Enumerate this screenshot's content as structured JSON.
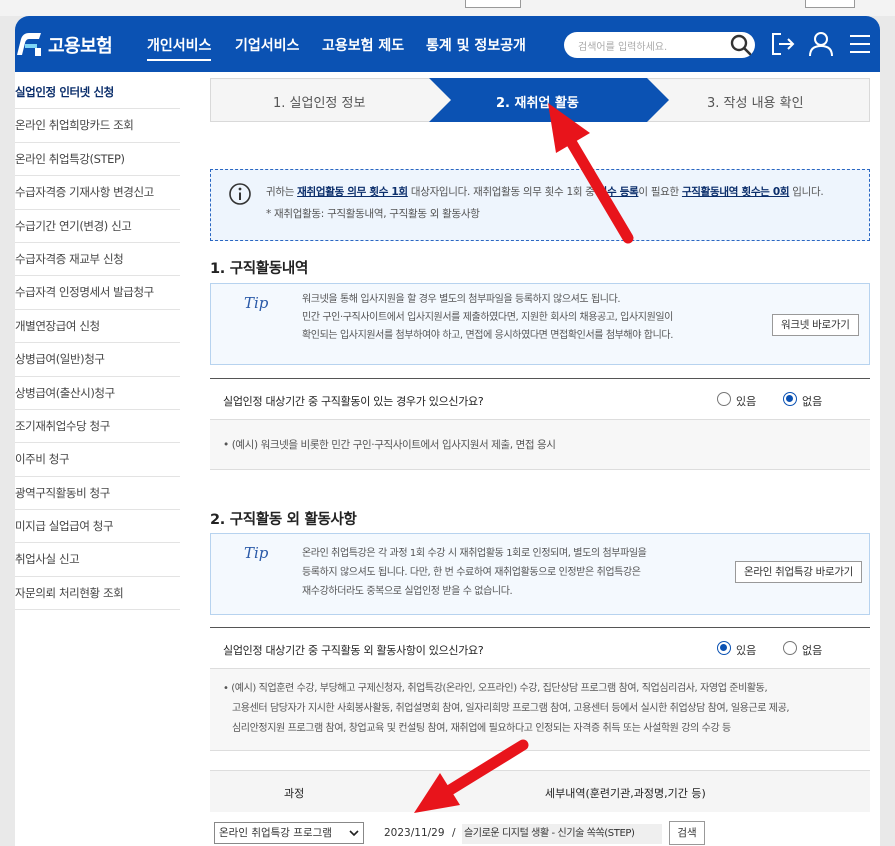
{
  "header": {
    "logo_text": "고용보험",
    "nav": [
      "개인서비스",
      "기업서비스",
      "고용보험 제도",
      "통계 및 정보공개"
    ],
    "search_placeholder": "검색어를 입력하세요."
  },
  "sidebar": {
    "items": [
      "실업인정 인터넷 신청",
      "온라인 취업희망카드 조회",
      "온라인 취업특강(STEP)",
      "수급자격증 기재사항 변경신고",
      "수급기간 연기(변경) 신고",
      "수급자격증 재교부 신청",
      "수급자격 인정명세서 발급청구",
      "개별연장급여 신청",
      "상병급여(일반)청구",
      "상병급여(출산시)청구",
      "조기재취업수당 청구",
      "이주비 청구",
      "광역구직활동비 청구",
      "미지급 실업급여 청구",
      "취업사실 신고",
      "자문의뢰 처리현황 조회"
    ]
  },
  "steps": [
    "1. 실업인정 정보",
    "2. 재취업 활동",
    "3. 작성 내용 확인"
  ],
  "notice": {
    "p1": "귀하는 ",
    "b1": "재취업활동 의무 횟수 1회",
    "p2": " 대상자입니다. 재취업활동 의무 횟수 1회 중 ",
    "b2": "필수 등록",
    "p3": "이 필요한 ",
    "b3": "구직활동내역 횟수는 0회",
    "p4": " 입니다.",
    "line2": "* 재취업활동: 구직활동내역, 구직활동 외 활동사항"
  },
  "section1": {
    "title": "1. 구직활동내역",
    "tip_logo": "Tip",
    "tip_lines": [
      "워크넷을 통해 입사지원을 할 경우 별도의 첨부파일을 등록하지 않으셔도 됩니다.",
      "민간 구인·구직사이트에서 입사지원서를 제출하였다면, 지원한 회사의 채용공고, 입사지원일이",
      "확인되는 입사지원서를 첨부하여야 하고, 면접에 응시하였다면 면접확인서를 첨부해야 합니다."
    ],
    "tip_button": "워크넷 바로가기",
    "question": "실업인정 대상기간 중 구직활동이 있는 경우가 있으신가요?",
    "yes": "있음",
    "no": "없음",
    "selected": "없음",
    "example": "• (예시) 워크넷을 비롯한 민간 구인·구직사이트에서 입사지원서 제출, 면접 응시"
  },
  "section2": {
    "title": "2. 구직활동 외 활동사항",
    "tip_logo": "Tip",
    "tip_lines": [
      "온라인 취업특강은 각 과정 1회 수강 시 재취업활동 1회로 인정되며, 별도의 첨부파일을",
      "등록하지 않으셔도 됩니다. 다만, 한 번 수료하여 재취업활동으로 인정받은 취업특강은",
      "재수강하더라도 중복으로 실업인정 받을 수 없습니다."
    ],
    "tip_button": "온라인 취업특강 바로가기",
    "question": "실업인정 대상기간 중 구직활동 외 활동사항이 있으신가요?",
    "yes": "있음",
    "no": "없음",
    "selected": "있음",
    "example_lines": [
      "• (예시) 직업훈련 수강, 부당해고 구제신청자, 취업특강(온라인, 오프라인) 수강, 집단상담 프로그램 참여, 직업심리검사, 자영업 준비활동,",
      "고용센터 담당자가 지시한 사회봉사활동, 취업설명회 참여, 일자리희망 프로그램 참여, 고용센터 등에서 실시한 취업상담 참여, 일용근로 제공,",
      "심리안정지원 프로그램 참여, 창업교육 및 컨설팅 참여, 재취업에 필요하다고 인정되는 자격증 취득 또는 사설학원 강의 수강 등"
    ]
  },
  "table": {
    "col1": "과정",
    "col2": "세부내역(훈련기관,과정명,기간 등)",
    "select_value": "온라인 취업특강 프로그램",
    "date": "2023/11/29",
    "slash": "/",
    "detail": "슬기로운 디지털 생활 - 신기술 쏙쏙(STEP)",
    "search_button": "검색"
  },
  "colors": {
    "primary": "#0b52b3",
    "arrow": "#e8141b"
  }
}
